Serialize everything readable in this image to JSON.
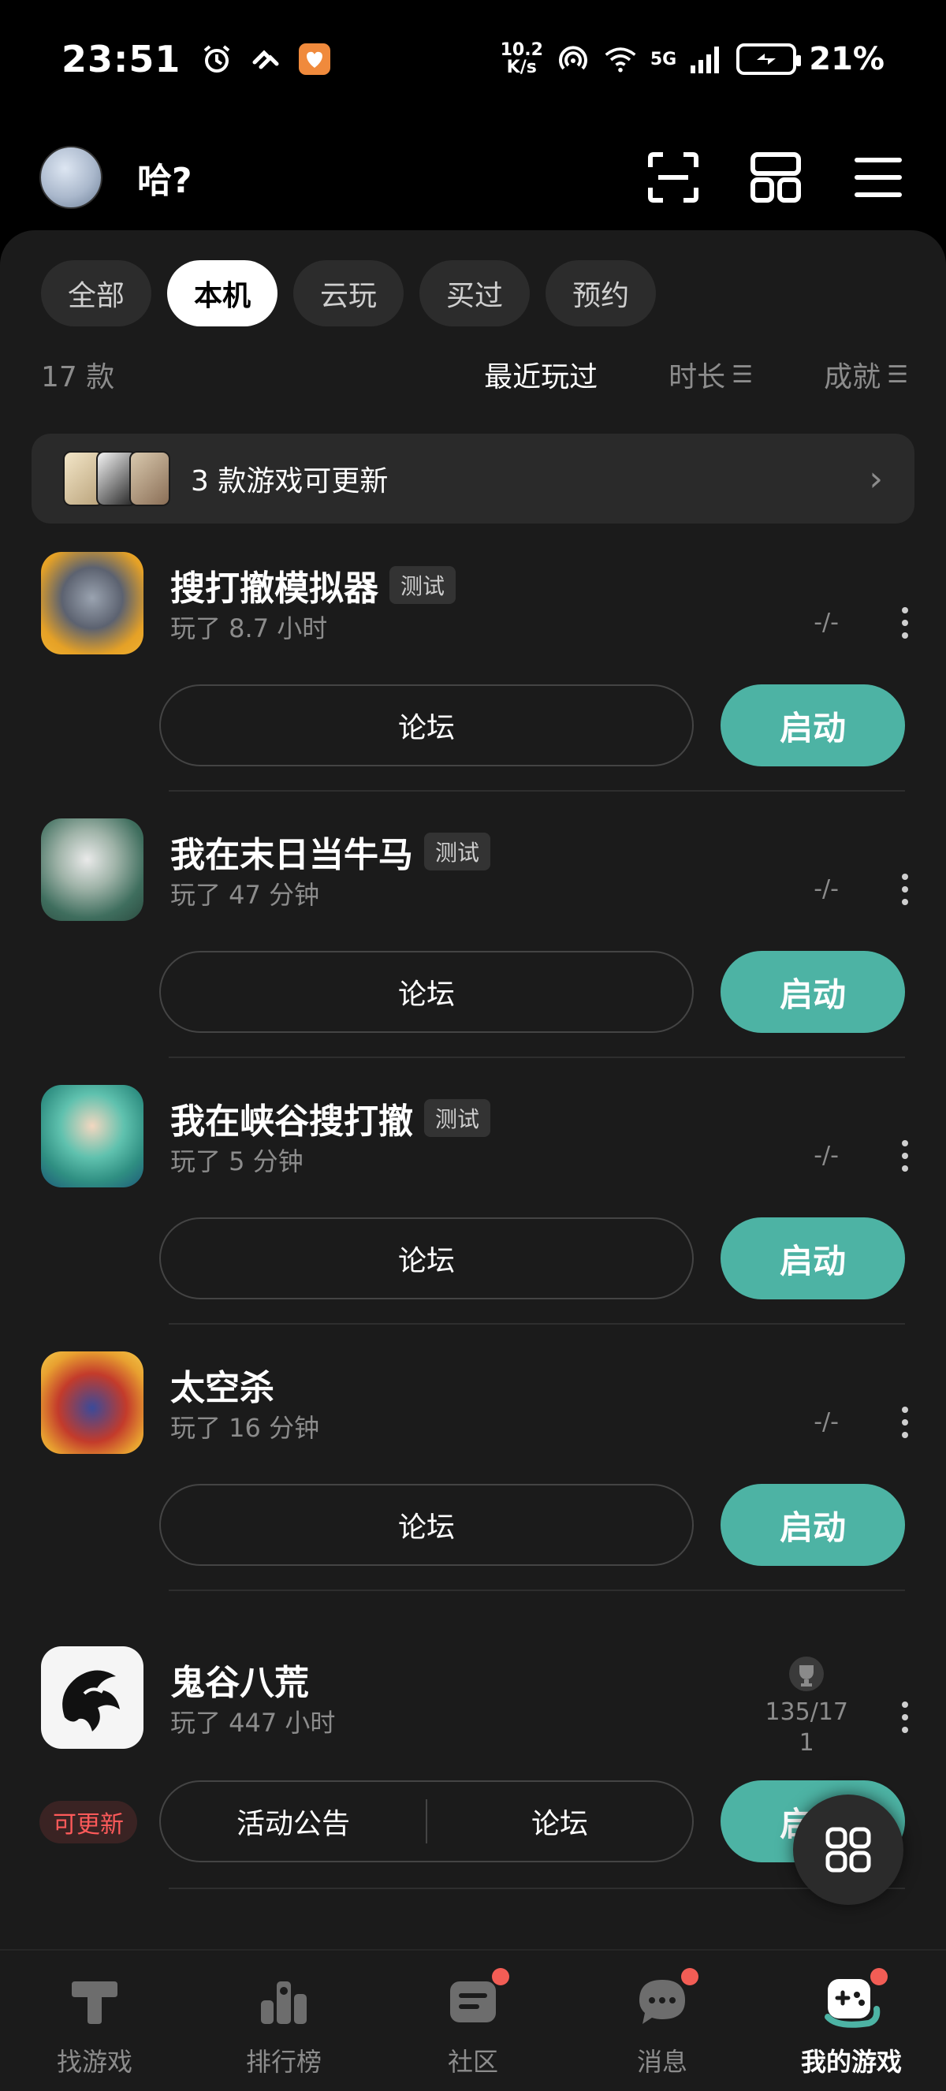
{
  "status_bar": {
    "time": "23:51",
    "net_speed_top": "10.2",
    "net_speed_bottom": "K/s",
    "network": "5G",
    "battery": "21%"
  },
  "header": {
    "username": "哈?"
  },
  "filters": [
    {
      "label": "全部",
      "active": false
    },
    {
      "label": "本机",
      "active": true
    },
    {
      "label": "云玩",
      "active": false
    },
    {
      "label": "买过",
      "active": false
    },
    {
      "label": "预约",
      "active": false
    }
  ],
  "sort": {
    "count": "17 款",
    "options": [
      "最近玩过",
      "时长",
      "成就"
    ]
  },
  "update_banner": {
    "text": "3 款游戏可更新"
  },
  "games": [
    {
      "title": "搜打撤模拟器",
      "tag": "测试",
      "playtime": "玩了 8.7 小时",
      "achievement": "-/-",
      "forum": "论坛",
      "start": "启动"
    },
    {
      "title": "我在末日当牛马",
      "tag": "测试",
      "playtime": "玩了 47 分钟",
      "achievement": "-/-",
      "forum": "论坛",
      "start": "启动"
    },
    {
      "title": "我在峡谷搜打撤",
      "tag": "测试",
      "playtime": "玩了 5 分钟",
      "achievement": "-/-",
      "forum": "论坛",
      "start": "启动"
    },
    {
      "title": "太空杀",
      "tag": "",
      "playtime": "玩了 16 分钟",
      "achievement": "-/-",
      "forum": "论坛",
      "start": "启动"
    },
    {
      "title": "鬼谷八荒",
      "tag": "",
      "playtime": "玩了 447 小时",
      "achievement_line1": "135/17",
      "achievement_line2": "1",
      "update_tag": "可更新",
      "announce": "活动公告",
      "forum": "论坛",
      "start": "启动"
    }
  ],
  "bottom_nav": [
    {
      "label": "找游戏",
      "icon": "find-games-icon",
      "active": false,
      "dot": false
    },
    {
      "label": "排行榜",
      "icon": "ranking-icon",
      "active": false,
      "dot": false
    },
    {
      "label": "社区",
      "icon": "community-icon",
      "active": false,
      "dot": true
    },
    {
      "label": "消息",
      "icon": "message-icon",
      "active": false,
      "dot": true
    },
    {
      "label": "我的游戏",
      "icon": "my-games-icon",
      "active": true,
      "dot": true
    }
  ],
  "colors": {
    "accent": "#4db3a4",
    "background": "#1b1b1b",
    "badge_red": "#f25d55"
  }
}
